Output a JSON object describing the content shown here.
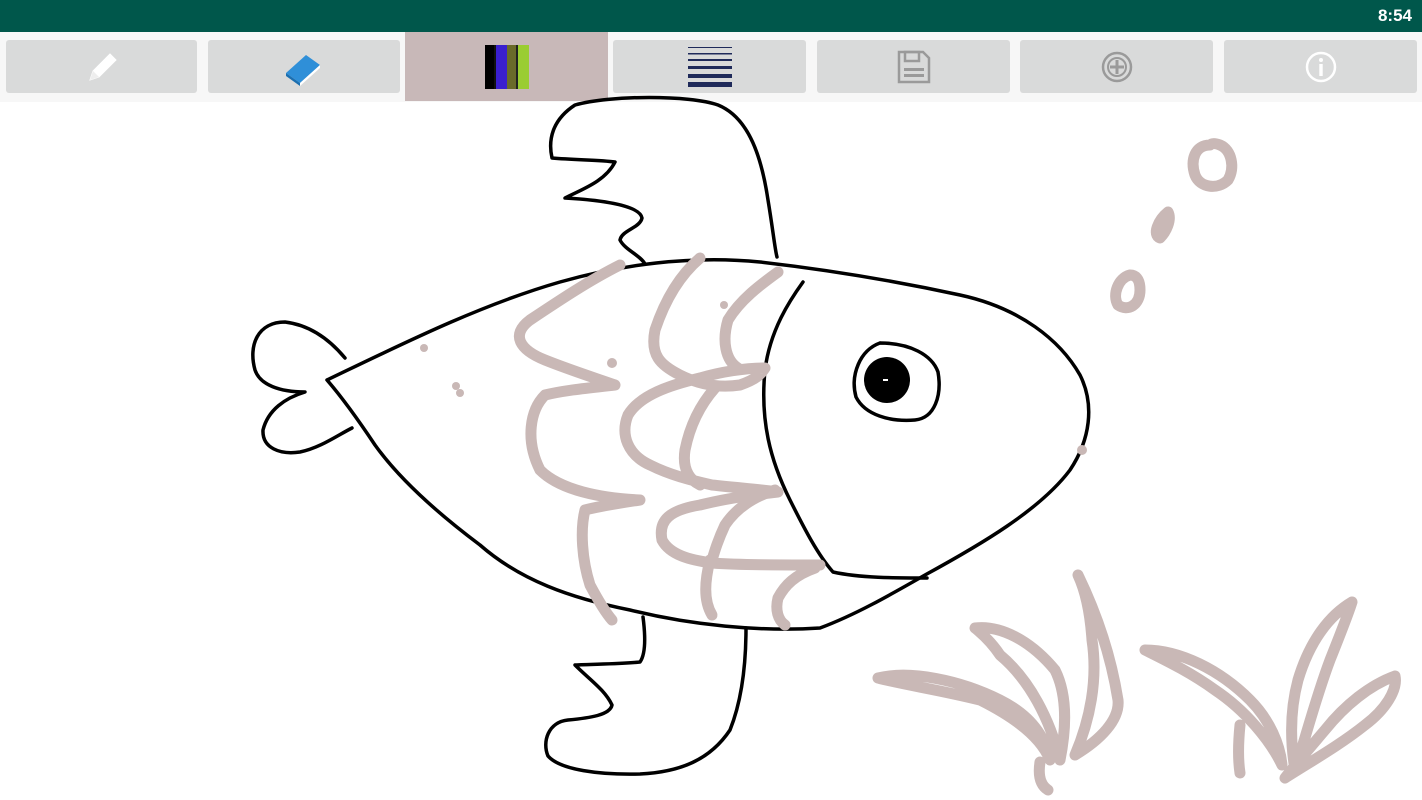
{
  "status_bar": {
    "time": "8:54"
  },
  "toolbar": {
    "tools": [
      {
        "id": "pencil",
        "icon": "pencil-icon"
      },
      {
        "id": "eraser",
        "icon": "eraser-icon"
      },
      {
        "id": "color-palette",
        "icon": "color-palette-icon",
        "selected": true
      },
      {
        "id": "stroke-width",
        "icon": "stroke-width-icon"
      },
      {
        "id": "save",
        "icon": "save-icon"
      },
      {
        "id": "new",
        "icon": "add-circle-icon"
      },
      {
        "id": "info",
        "icon": "info-icon"
      }
    ]
  },
  "colors": {
    "status_bar": "#00574b",
    "tool_background": "#d9dada",
    "tool_selected": "#c8b8b8",
    "ink": "#000000",
    "paint": "#c9b8b6",
    "eraser": "#2f8fd8",
    "palette": [
      "#000000",
      "#3a1fcf",
      "#6a6a2a",
      "#9acd32"
    ]
  }
}
